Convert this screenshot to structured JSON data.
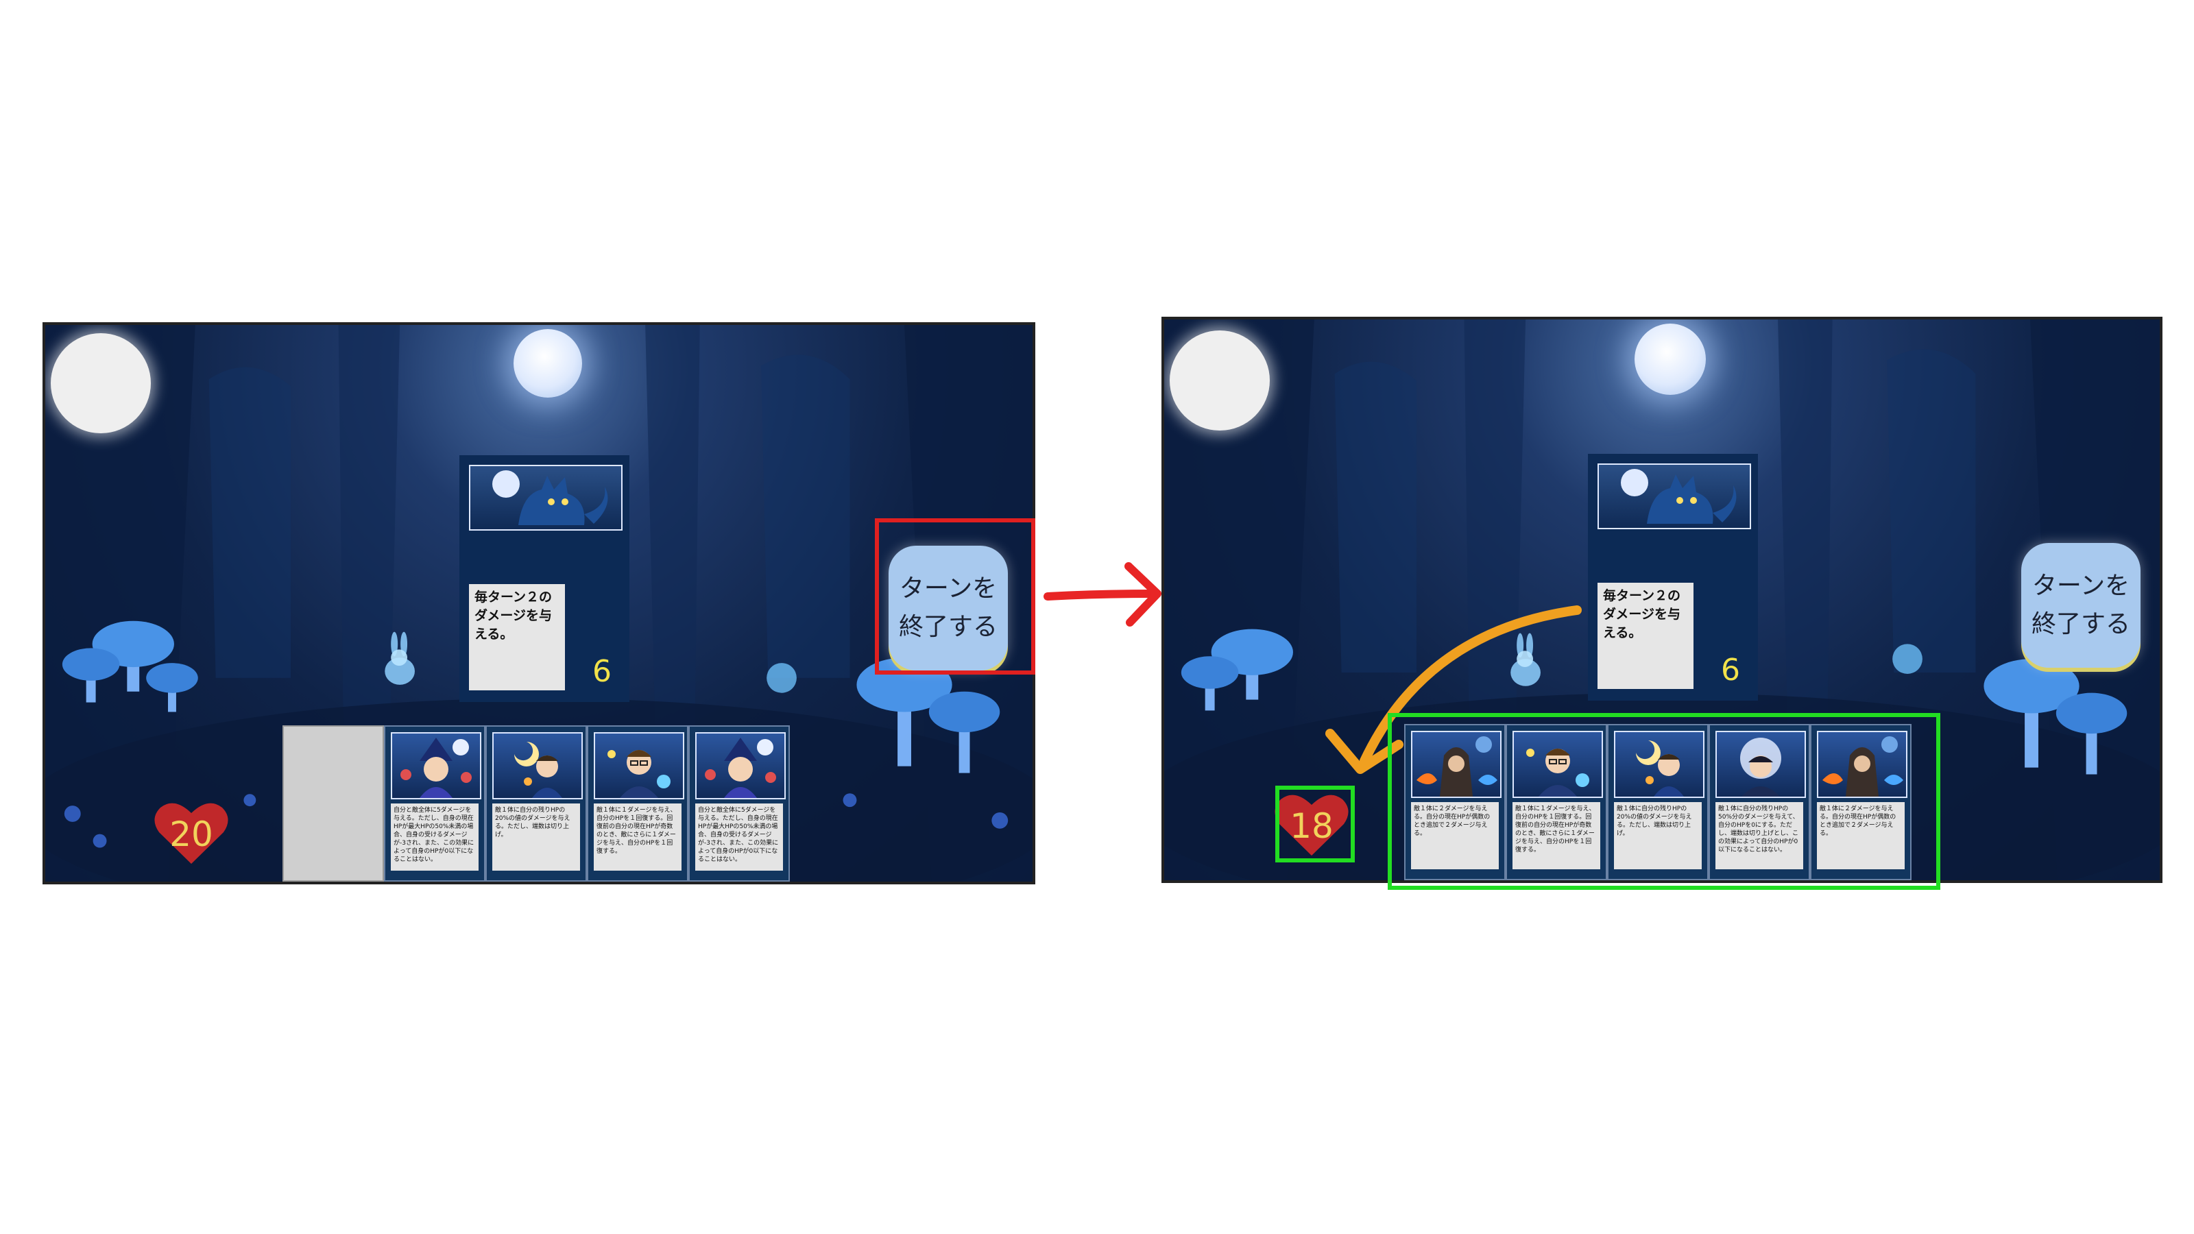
{
  "colors": {
    "end_turn_highlight": "#e02020",
    "arrow_between_panels": "#e82525",
    "hand_highlight": "#22dd22",
    "attack_arrow": "#f0a020",
    "power_text": "#f2e24a",
    "hp_heart": "#c0282a"
  },
  "before": {
    "enemy": {
      "art_icon": "moon-wolf-icon",
      "description": "毎ターン２のダメージを与える。",
      "power": "6"
    },
    "end_turn_label": "ターンを\n終了する",
    "player_hp": "20",
    "hand": [
      {
        "empty": true
      },
      {
        "art_icon": "witch-girl-icon",
        "text": "自分と敵全体に5ダメージを与える。ただし、自身の現在HPが最大HPの50%未満の場合、自身の受けるダメージが-3され、また、この効果によって自身のHPが0以下になることはない。"
      },
      {
        "art_icon": "boy-moon-icon",
        "text": "敵１体に自分の残りHPの20%の値のダメージを与える。ただし、端数は切り上げ。"
      },
      {
        "art_icon": "glasses-mage-icon",
        "text": "敵１体に１ダメージを与え、自分のHPを１回復する。回復前の自分の現在HPが奇数のとき、敵にさらに１ダメージを与え、自分のHPを１回復する。"
      },
      {
        "art_icon": "witch-girl-icon",
        "text": "自分と敵全体に5ダメージを与える。ただし、自身の現在HPが最大HPの50%未満の場合、自身の受けるダメージが-3され、また、この効果によって自身のHPが0以下になることはない。"
      }
    ]
  },
  "after": {
    "enemy": {
      "art_icon": "moon-wolf-icon",
      "description": "毎ターン２のダメージを与える。",
      "power": "6"
    },
    "end_turn_label": "ターンを\n終了する",
    "player_hp": "18",
    "hand": [
      {
        "art_icon": "hooded-mage-icon",
        "text": "敵１体に２ダメージを与える。自分の現在HPが偶数のとき追加で２ダメージ与える。"
      },
      {
        "art_icon": "glasses-mage-icon",
        "text": "敵１体に１ダメージを与え、自分のHPを１回復する。回復前の自分の現在HPが奇数のとき、敵にさらに１ダメージを与え、自分のHPを１回復する。"
      },
      {
        "art_icon": "boy-moon-icon",
        "text": "敵１体に自分の残りHPの20%の値のダメージを与える。ただし、端数は切り上げ。"
      },
      {
        "art_icon": "moon-swordsman-icon",
        "text": "敵１体に自分の残りHPの50%分のダメージを与えて、自分のHPを0にする。ただし、端数は切り上げとし、この効果によって自分のHPが0以下になることはない。"
      },
      {
        "art_icon": "hooded-mage-icon",
        "text": "敵１体に２ダメージを与える。自分の現在HPが偶数のとき追加で２ダメージ与える。"
      }
    ]
  }
}
